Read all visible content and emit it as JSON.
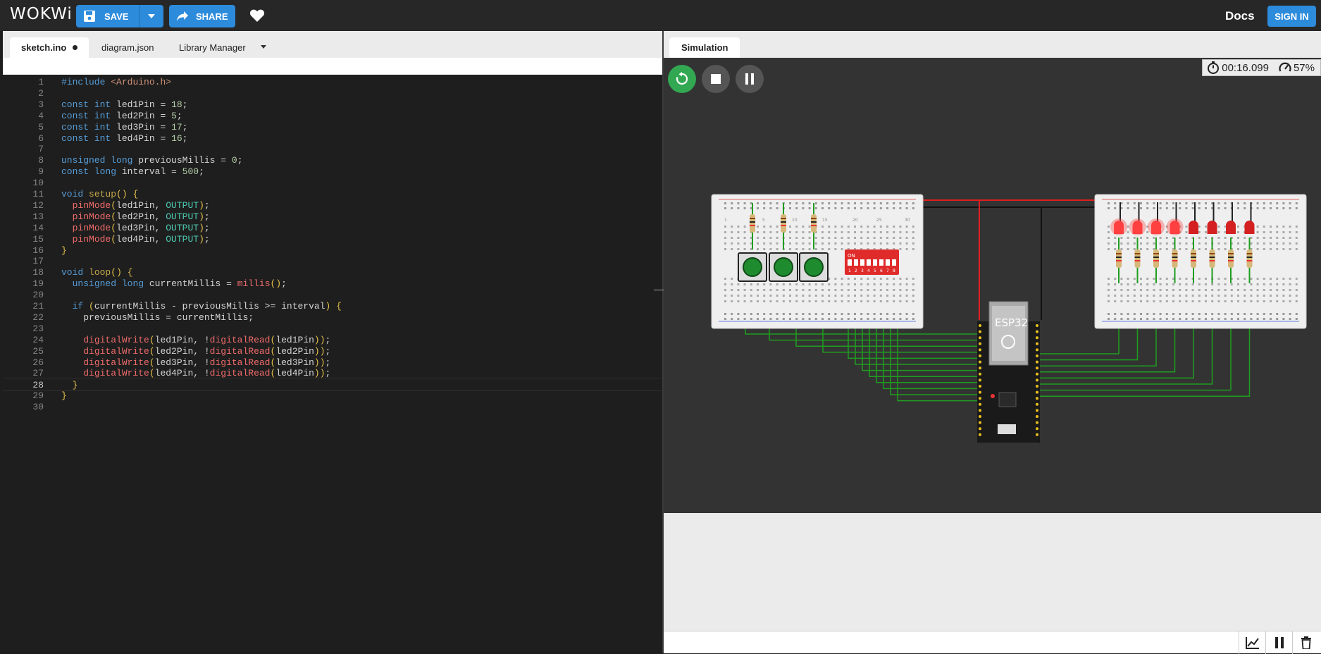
{
  "header": {
    "logo": "WOKWi",
    "save_label": "SAVE",
    "share_label": "SHARE",
    "docs_label": "Docs",
    "signin_label": "SIGN IN",
    "accent_color": "#2d8bdc"
  },
  "editor": {
    "tabs": [
      {
        "label": "sketch.ino",
        "active": true,
        "modified": true
      },
      {
        "label": "diagram.json",
        "active": false
      },
      {
        "label": "Library Manager",
        "active": false
      }
    ],
    "current_line": 28,
    "lines": [
      {
        "n": "1",
        "text": "#include <Arduino.h>"
      },
      {
        "n": "2",
        "text": ""
      },
      {
        "n": "3",
        "text": "const int led1Pin = 18;"
      },
      {
        "n": "4",
        "text": "const int led2Pin = 5;"
      },
      {
        "n": "5",
        "text": "const int led3Pin = 17;"
      },
      {
        "n": "6",
        "text": "const int led4Pin = 16;"
      },
      {
        "n": "7",
        "text": ""
      },
      {
        "n": "8",
        "text": "unsigned long previousMillis = 0;"
      },
      {
        "n": "9",
        "text": "const long interval = 500;"
      },
      {
        "n": "10",
        "text": ""
      },
      {
        "n": "11",
        "text": "void setup() {"
      },
      {
        "n": "12",
        "text": "  pinMode(led1Pin, OUTPUT);"
      },
      {
        "n": "13",
        "text": "  pinMode(led2Pin, OUTPUT);"
      },
      {
        "n": "14",
        "text": "  pinMode(led3Pin, OUTPUT);"
      },
      {
        "n": "15",
        "text": "  pinMode(led4Pin, OUTPUT);"
      },
      {
        "n": "16",
        "text": "}"
      },
      {
        "n": "17",
        "text": ""
      },
      {
        "n": "18",
        "text": "void loop() {"
      },
      {
        "n": "19",
        "text": "  unsigned long currentMillis = millis();"
      },
      {
        "n": "20",
        "text": ""
      },
      {
        "n": "21",
        "text": "  if (currentMillis - previousMillis >= interval) {"
      },
      {
        "n": "22",
        "text": "    previousMillis = currentMillis;"
      },
      {
        "n": "23",
        "text": ""
      },
      {
        "n": "24",
        "text": "    digitalWrite(led1Pin, !digitalRead(led1Pin));"
      },
      {
        "n": "25",
        "text": "    digitalWrite(led2Pin, !digitalRead(led2Pin));"
      },
      {
        "n": "26",
        "text": "    digitalWrite(led3Pin, !digitalRead(led3Pin));"
      },
      {
        "n": "27",
        "text": "    digitalWrite(led4Pin, !digitalRead(led4Pin));"
      },
      {
        "n": "28",
        "text": "  }"
      },
      {
        "n": "29",
        "text": "}"
      },
      {
        "n": "30",
        "text": ""
      }
    ]
  },
  "simulation": {
    "tab_label": "Simulation",
    "elapsed": "00:16.099",
    "speed": "57%",
    "chip_label": "ESP32",
    "dip_label": "ON",
    "dip_numbers": [
      "1",
      "2",
      "3",
      "4",
      "5",
      "6",
      "7",
      "8"
    ],
    "breadboard_numbers": [
      "1",
      "5",
      "10",
      "15",
      "20",
      "25",
      "30"
    ]
  },
  "colors": {
    "led_on": "#e33",
    "wire_green": "#1f9e1f",
    "wire_red": "#e02020",
    "button_green": "#1e8b2e"
  }
}
